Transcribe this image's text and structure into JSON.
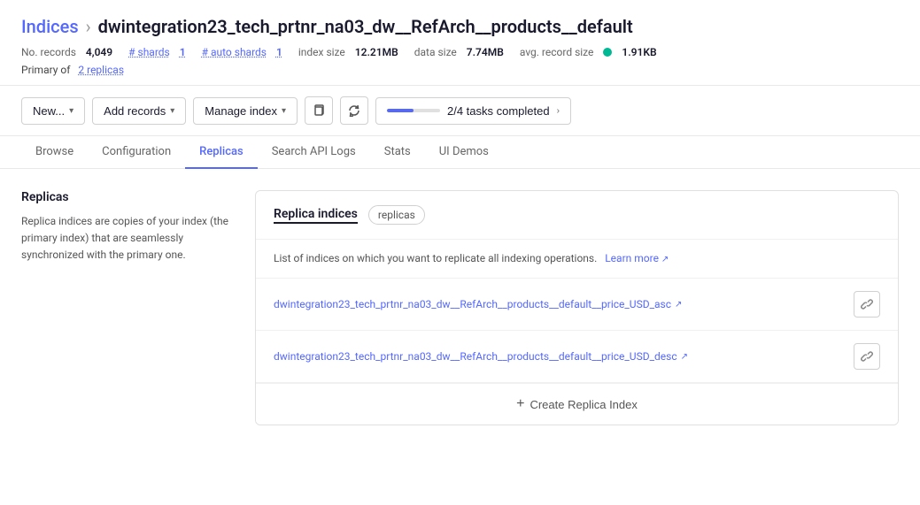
{
  "breadcrumb": {
    "parent": "Indices",
    "separator": "›",
    "current": "dwintegration23_tech_prtnr_na03_dw__RefArch__products__default"
  },
  "meta": {
    "no_records_label": "No. records",
    "no_records_value": "4,049",
    "shards_label": "# shards",
    "shards_value": "1",
    "auto_shards_label": "# auto shards",
    "auto_shards_value": "1",
    "index_size_label": "index size",
    "index_size_value": "12.21MB",
    "data_size_label": "data size",
    "data_size_value": "7.74MB",
    "avg_record_size_label": "avg. record size",
    "avg_record_size_value": "1.91KB",
    "primary_of_label": "Primary of",
    "replicas_count": "2 replicas"
  },
  "toolbar": {
    "new_label": "New...",
    "add_records_label": "Add records",
    "manage_index_label": "Manage index",
    "tasks_label": "2/4 tasks completed",
    "progress_percent": 50
  },
  "tabs": [
    {
      "id": "browse",
      "label": "Browse"
    },
    {
      "id": "configuration",
      "label": "Configuration"
    },
    {
      "id": "replicas",
      "label": "Replicas",
      "active": true
    },
    {
      "id": "search-api-logs",
      "label": "Search API Logs"
    },
    {
      "id": "stats",
      "label": "Stats"
    },
    {
      "id": "ui-demos",
      "label": "UI Demos"
    }
  ],
  "sidebar": {
    "title": "Replicas",
    "description": "Replica indices are copies of your index (the primary index) that are seamlessly synchronized with the primary one."
  },
  "panel": {
    "title": "Replica indices",
    "badge": "replicas",
    "description": "List of indices on which you want to replicate all indexing operations.",
    "learn_more_label": "Learn more",
    "replicas": [
      {
        "id": "replica-1",
        "name": "dwintegration23_tech_prtnr_na03_dw__RefArch__products__default__price_USD_asc"
      },
      {
        "id": "replica-2",
        "name": "dwintegration23_tech_prtnr_na03_dw__RefArch__products__default__price_USD_desc"
      }
    ],
    "create_replica_label": "Create Replica Index"
  }
}
